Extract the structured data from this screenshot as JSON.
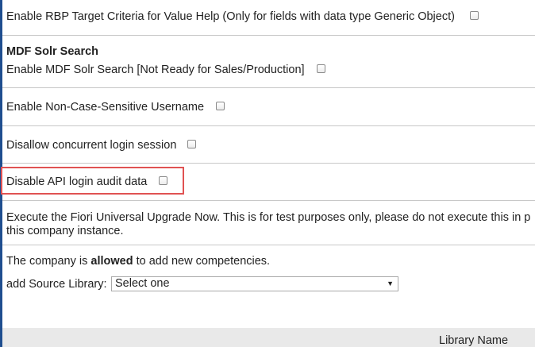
{
  "settings": {
    "rbp_target_criteria_label": "Enable RBP Target Criteria for Value Help (Only for fields with data type Generic Object)",
    "mdf_section_title": "MDF Solr Search",
    "mdf_solr_label": "Enable MDF Solr Search [Not Ready for Sales/Production]",
    "non_case_sensitive_label": "Enable Non-Case-Sensitive Username",
    "concurrent_login_label": "Disallow concurrent login session",
    "api_audit_label": "Disable API login audit data",
    "fiori_upgrade_line1": "Execute the Fiori Universal Upgrade Now. This is for test purposes only, please do not execute this in p",
    "fiori_upgrade_line2": "this company instance."
  },
  "competencies": {
    "prefix": "The company is ",
    "status": "allowed",
    "suffix": " to add new competencies.",
    "source_library_label": "add Source Library:",
    "source_library_selected": "Select one"
  },
  "table": {
    "columns": [
      "Library Name"
    ]
  },
  "colors": {
    "left_bar": "#1f4e8f",
    "highlight_border": "#e05252",
    "divider": "#c8c8c8",
    "table_header_bg": "#e9e9e9"
  },
  "icons": {
    "select_arrow": "▼"
  }
}
